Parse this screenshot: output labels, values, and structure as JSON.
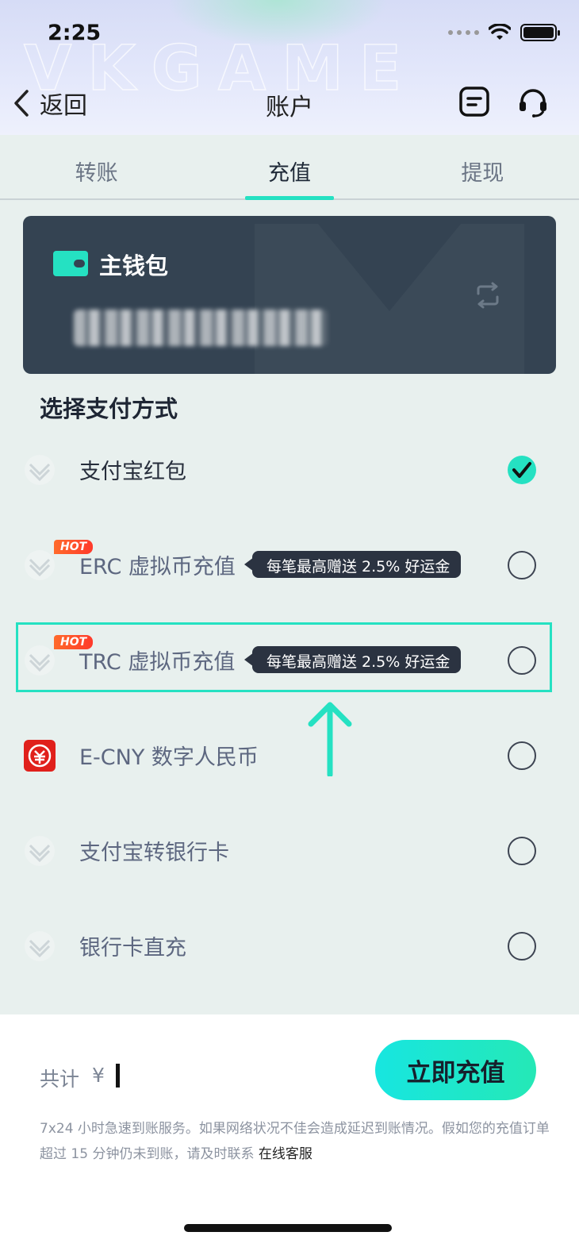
{
  "status_bar": {
    "time": "2:25"
  },
  "header": {
    "back_label": "返回",
    "title": "账户"
  },
  "tabs": [
    {
      "label": "转账",
      "active": false
    },
    {
      "label": "充值",
      "active": true
    },
    {
      "label": "提现",
      "active": false
    }
  ],
  "wallet": {
    "title": "主钱包"
  },
  "payment": {
    "section_title": "选择支付方式",
    "methods": [
      {
        "label": "支付宝红包",
        "checked": true,
        "hot": false,
        "promo": ""
      },
      {
        "label": "ERC 虚拟币充值",
        "checked": false,
        "hot": true,
        "hot_label": "HOT",
        "promo": "每笔最高赠送 2.5% 好运金"
      },
      {
        "label": "TRC 虚拟币充值",
        "checked": false,
        "hot": true,
        "hot_label": "HOT",
        "promo": "每笔最高赠送 2.5% 好运金"
      },
      {
        "label": "E-CNY 数字人民币",
        "checked": false,
        "hot": false,
        "promo": ""
      },
      {
        "label": "支付宝转银行卡",
        "checked": false,
        "hot": false,
        "promo": ""
      },
      {
        "label": "银行卡直充",
        "checked": false,
        "hot": false,
        "promo": ""
      }
    ]
  },
  "footer": {
    "total_label": "共计",
    "currency": "¥",
    "submit_label": "立即充值",
    "notice_text": "7x24 小时急速到账服务。如果网络状况不佳会造成延迟到账情况。假如您的充值订单超过 15 分钟仍未到账，请及时联系",
    "support_link": "在线客服"
  },
  "colors": {
    "accent": "#25e1c2",
    "card_bg": "#344352",
    "hot": "#ff4a2b"
  }
}
